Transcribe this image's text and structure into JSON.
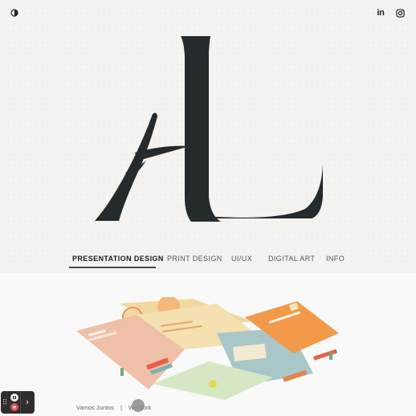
{
  "header": {
    "theme_toggle_icon": "half-circle-contrast-icon",
    "social": [
      {
        "name": "linkedin-icon",
        "label": "in"
      },
      {
        "name": "instagram-icon"
      }
    ]
  },
  "logo": {
    "letters": "AL"
  },
  "nav": {
    "tabs": [
      {
        "label": "PRESENTATION DESIGN",
        "active": true
      },
      {
        "label": "PRINT DESIGN",
        "active": false
      },
      {
        "label": "UI/UX",
        "active": false
      },
      {
        "label": "DIGITAL ART",
        "active": false
      },
      {
        "label": "INFO",
        "active": false
      }
    ]
  },
  "gallery": {
    "caption": {
      "left": "Vamos Juntos",
      "separator": "|",
      "right": "WeWork"
    }
  },
  "colors": {
    "ink": "#252a2d",
    "accent_orange": "#f29a4a",
    "accent_peach": "#f0bfa8",
    "accent_teal": "#a8c8c8",
    "accent_cream": "#f3dfa9",
    "accent_mint": "#c9e2c1"
  }
}
